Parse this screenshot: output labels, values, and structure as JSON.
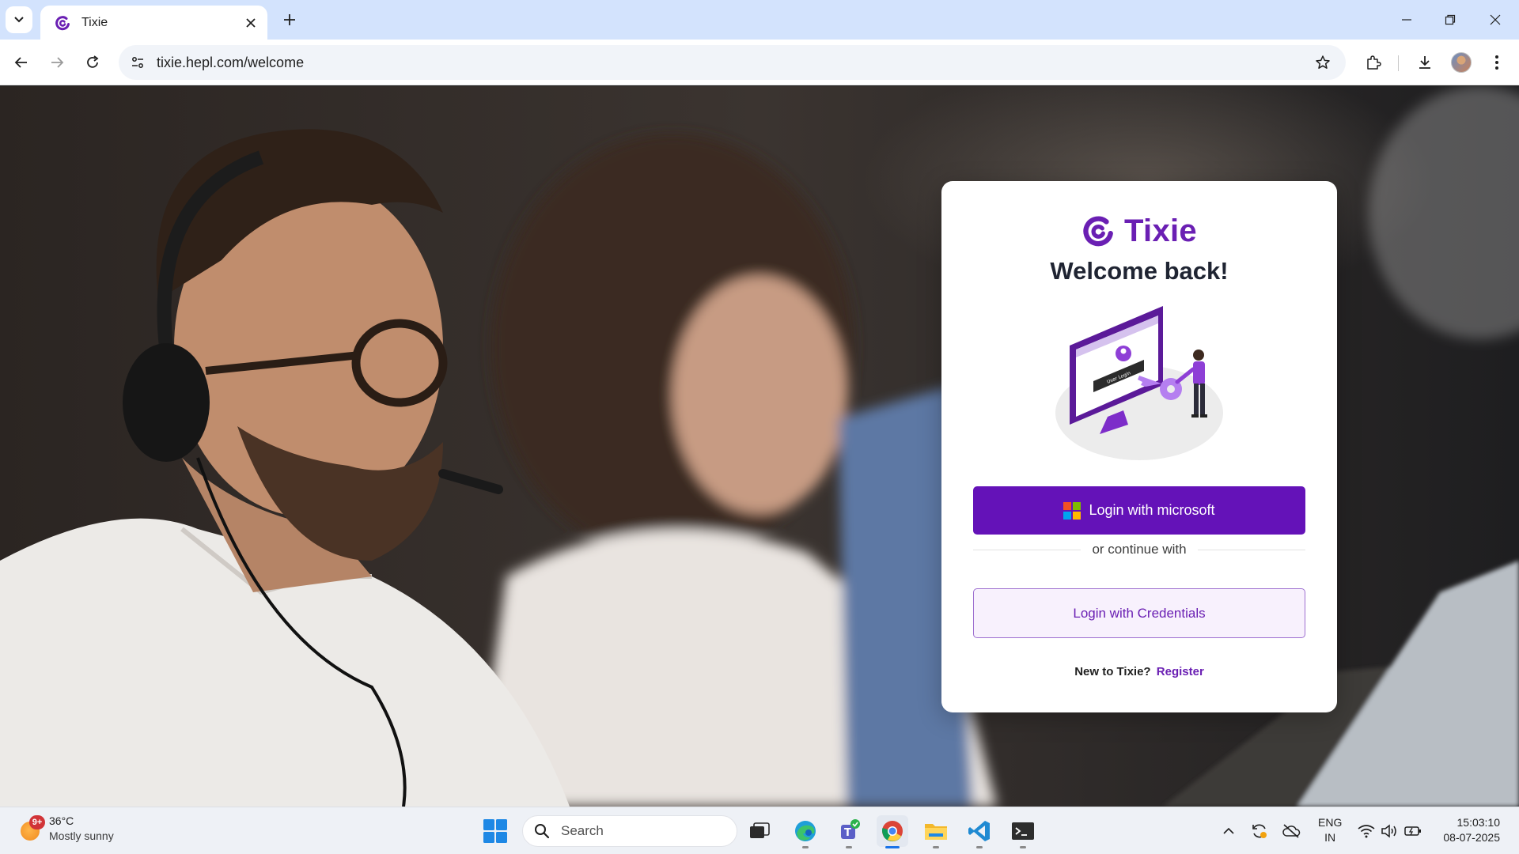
{
  "browser": {
    "tab_title": "Tixie",
    "url": "tixie.hepl.com/welcome"
  },
  "card": {
    "brand_name": "Tixie",
    "heading": "Welcome back!",
    "ms_button_label": "Login with microsoft",
    "divider_text": "or continue with",
    "credentials_button_label": "Login with Credentials",
    "register_prompt": "New to Tixie?",
    "register_link": "Register",
    "illustration_screen_text": "User Login"
  },
  "taskbar": {
    "weather_badge": "9+",
    "weather_temp": "36°C",
    "weather_condition": "Mostly sunny",
    "search_label": "Search",
    "lang_top": "ENG",
    "lang_bottom": "IN",
    "time": "15:03:10",
    "date": "08-07-2025"
  },
  "colors": {
    "brand_purple": "#6412b8",
    "tab_strip": "#d3e3fd",
    "ms_red": "#f25022",
    "ms_green": "#7fba00",
    "ms_blue": "#00a4ef",
    "ms_yellow": "#ffb900"
  },
  "icons": [
    "tab-search-icon",
    "tixie-logo-icon",
    "close-icon",
    "plus-icon",
    "minimize-icon",
    "restore-icon",
    "back-icon",
    "forward-icon",
    "reload-icon",
    "site-info-icon",
    "star-icon",
    "extensions-icon",
    "download-icon",
    "more-icon",
    "windows-start-icon",
    "search-icon",
    "task-view-icon",
    "edge-icon",
    "teams-icon",
    "chrome-icon",
    "file-explorer-icon",
    "vscode-icon",
    "terminal-icon",
    "chevron-up-icon",
    "sync-icon",
    "cloud-off-icon",
    "wifi-icon",
    "volume-icon",
    "battery-icon"
  ]
}
